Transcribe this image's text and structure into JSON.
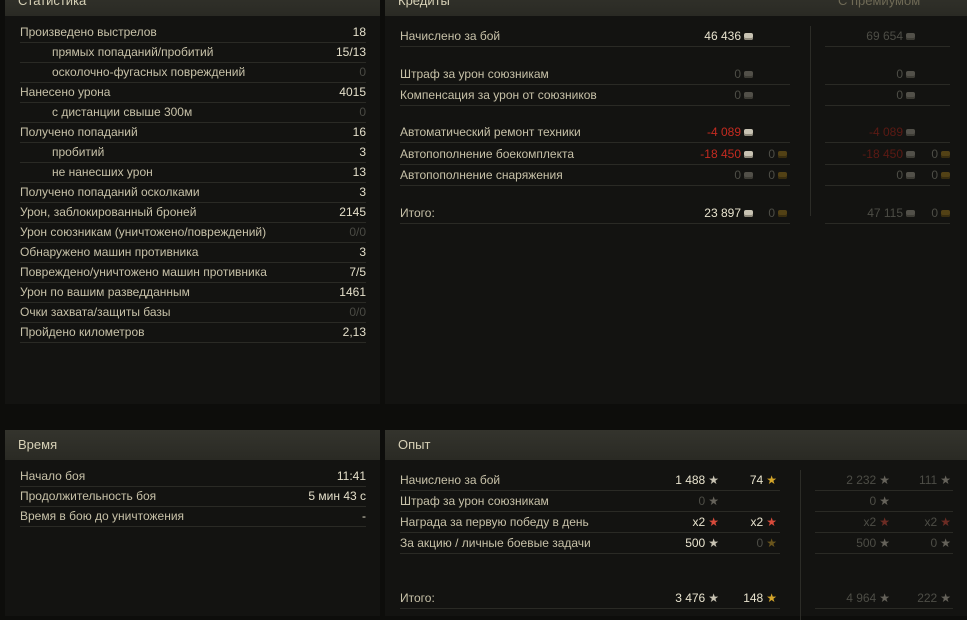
{
  "stats": {
    "title": "Статистика",
    "rows": [
      {
        "label": "Произведено выстрелов",
        "value": "18"
      },
      {
        "label": "прямых попаданий/пробитий",
        "value": "15/13"
      },
      {
        "label": "осколочно-фугасных повреждений",
        "value": "0"
      },
      {
        "label": "Нанесено урона",
        "value": "4015"
      },
      {
        "label": "с дистанции свыше 300м",
        "value": "0"
      },
      {
        "label": "Получено попаданий",
        "value": "16"
      },
      {
        "label": "пробитий",
        "value": "3"
      },
      {
        "label": "не нанесших урон",
        "value": "13"
      },
      {
        "label": "Получено попаданий осколками",
        "value": "3"
      },
      {
        "label": "Урон, заблокированный броней",
        "value": "2145"
      },
      {
        "label": "Урон союзникам (уничтожено/повреждений)",
        "value": "0/0"
      },
      {
        "label": "Обнаружено машин противника",
        "value": "3"
      },
      {
        "label": "Повреждено/уничтожено машин противника",
        "value": "7/5"
      },
      {
        "label": "Урон по вашим разведданным",
        "value": "1461"
      },
      {
        "label": "Очки захвата/защиты базы",
        "value": "0/0"
      },
      {
        "label": "Пройдено километров",
        "value": "2,13"
      }
    ]
  },
  "credits": {
    "title": "Кредиты",
    "premium_header": "С премиумом",
    "rows": [
      {
        "label": "Начислено за бой",
        "credits": "46 436",
        "gold": "",
        "prem_credits": "69 654",
        "prem_gold": ""
      },
      {
        "label": "Штраф за урон союзникам",
        "credits": "0",
        "gold": "",
        "prem_credits": "0",
        "prem_gold": ""
      },
      {
        "label": "Компенсация за урон от союзников",
        "credits": "0",
        "gold": "",
        "prem_credits": "0",
        "prem_gold": ""
      },
      {
        "label": "Автоматический ремонт техники",
        "credits": "-4 089",
        "gold": "",
        "prem_credits": "-4 089",
        "prem_gold": ""
      },
      {
        "label": "Автопополнение боекомплекта",
        "credits": "-18 450",
        "gold": "0",
        "prem_credits": "-18 450",
        "prem_gold": "0"
      },
      {
        "label": "Автопополнение снаряжения",
        "credits": "0",
        "gold": "0",
        "prem_credits": "0",
        "prem_gold": "0"
      },
      {
        "label": "Итого:",
        "credits": "23 897",
        "gold": "0",
        "prem_credits": "47 115",
        "prem_gold": "0"
      }
    ]
  },
  "time": {
    "title": "Время",
    "rows": [
      {
        "label": "Начало боя",
        "value": "11:41"
      },
      {
        "label": "Продолжительность боя",
        "value": "5 мин 43 с"
      },
      {
        "label": "Время в бою до уничтожения",
        "value": "-"
      }
    ]
  },
  "xp": {
    "title": "Опыт",
    "rows": [
      {
        "label": "Начислено за бой",
        "xp": "1 488",
        "free": "74",
        "prem_xp": "2 232",
        "prem_free": "111"
      },
      {
        "label": "Штраф за урон союзникам",
        "xp": "0",
        "free": "",
        "prem_xp": "0",
        "prem_free": ""
      },
      {
        "label": "Награда за первую победу в день",
        "xp": "x2",
        "free": "x2",
        "prem_xp": "x2",
        "prem_free": "x2"
      },
      {
        "label": "За акцию / личные боевые задачи",
        "xp": "500",
        "free": "0",
        "prem_xp": "500",
        "prem_free": "0"
      },
      {
        "label": "Итого:",
        "xp": "3 476",
        "free": "148",
        "prem_xp": "4 964",
        "prem_free": "222"
      }
    ]
  },
  "colors": {
    "accent": "#e4dfca",
    "negative": "#c42b20",
    "gold": "#c9961f",
    "background": "#131311"
  }
}
